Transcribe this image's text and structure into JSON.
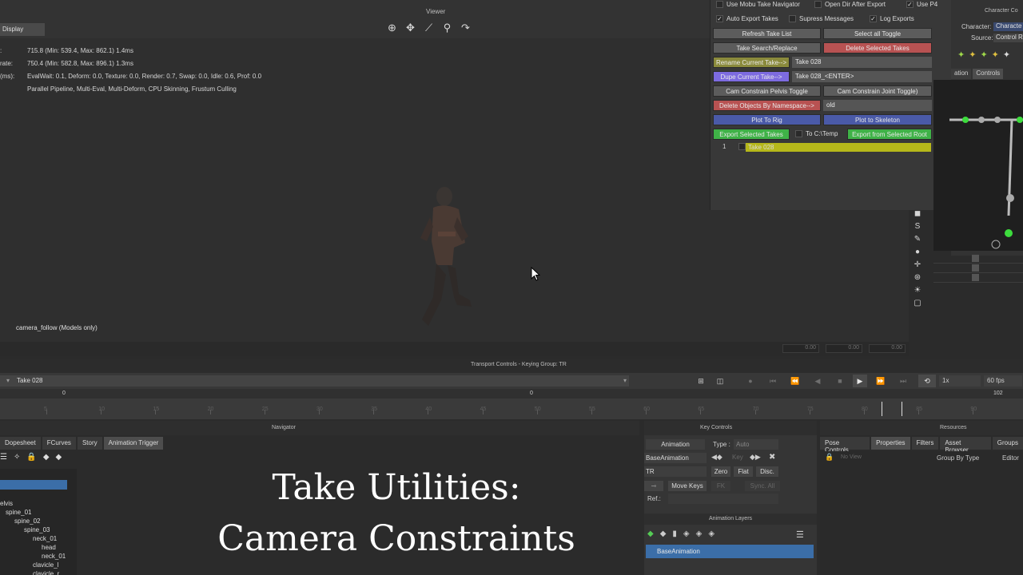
{
  "viewer": {
    "title": "Viewer",
    "display_tab": "Display",
    "stats": [
      {
        "key": ":",
        "value": "715.8  (Min: 539.4, Max: 862.1)  1.4ms"
      },
      {
        "key": "rate:",
        "value": "750.4  (Min: 582.8, Max: 896.1)  1.3ms"
      },
      {
        "key": "(ms):",
        "value": "EvalWait: 0.1, Deform: 0.0, Texture: 0.0, Render: 0.7, Swap: 0.0, Idle: 0.6, Prof: 0.0"
      },
      {
        "key": "",
        "value": "Parallel Pipeline, Multi-Eval, Multi-Deform, CPU Skinning, Frustum Culling"
      }
    ],
    "model_label": "camera_follow (Models only)",
    "bottom_values": [
      "0.00",
      "0.00",
      "0.00"
    ]
  },
  "panel": {
    "checks_row1": [
      {
        "label": "Use Mobu Take Navigator",
        "checked": false
      },
      {
        "label": "Open Dir After Export",
        "checked": false
      },
      {
        "label": "Use P4",
        "checked": true
      }
    ],
    "checks_row2": [
      {
        "label": "Auto Export Takes",
        "checked": true
      },
      {
        "label": "Supress Messages",
        "checked": false
      },
      {
        "label": "Log Exports",
        "checked": true
      }
    ],
    "refresh": "Refresh Take List",
    "select_all": "Select all Toggle",
    "search_replace": "Take Search/Replace",
    "delete_selected": "Delete Selected Takes",
    "rename_current": "Rename Current Take-->",
    "rename_value": "Take 028",
    "dupe_current": "Dupe Current Take-->",
    "dupe_value": "Take 028_<ENTER>",
    "cam_pelvis": "Cam Constrain Pelvis Toggle",
    "cam_joint": "Cam Constrain Joint Toggle)",
    "delete_ns": "Delete Objects By Namespace-->",
    "ns_value": "old",
    "plot_rig": "Plot To Rig",
    "plot_skel": "Plot to Skeleton",
    "export_selected": "Export Selected Takes",
    "to_temp": "To C:\\Temp",
    "export_root": "Export from Selected Root",
    "take_index": "1",
    "take_name": "Take 028"
  },
  "character": {
    "title": "Character Co",
    "character_label": "Character:",
    "character_value": "Characte",
    "source_label": "Source:",
    "source_value": "Control R",
    "tab1": "ation",
    "tab2": "Controls"
  },
  "transport": {
    "title": "Transport Controls  -  Keying Group: TR",
    "take": "Take 028",
    "speed": "1x",
    "fps": "60 fps",
    "start_frame": "0",
    "end_frame": "102",
    "mid_frame": "0",
    "ruler_labels": [
      "5",
      "10",
      "15",
      "20",
      "25",
      "30",
      "35",
      "40",
      "45",
      "50",
      "55",
      "60",
      "65",
      "70",
      "75",
      "80",
      "85",
      "90"
    ]
  },
  "bottom": {
    "navigator_title": "Navigator",
    "tabs": [
      "Dopesheet",
      "FCurves",
      "Story",
      "Animation Trigger"
    ],
    "tree": [
      "elvis",
      "spine_01",
      "spine_02",
      "spine_03",
      "neck_01",
      "head",
      "neck_01",
      "clavicle_l",
      "clavicle_r"
    ],
    "overlay_line1": "Take Utilities:",
    "overlay_line2": "Camera Constraints",
    "key_controls_title": "Key Controls",
    "kc_animation": "Animation",
    "kc_type_label": "Type :",
    "kc_type_value": "Auto",
    "kc_layer": "BaseAnimation",
    "kc_key": "Key",
    "kc_tr": "TR",
    "kc_zero": "Zero",
    "kc_flat": "Flat",
    "kc_disc": "Disc.",
    "kc_move": "Move Keys",
    "kc_fk": "FK",
    "kc_sync": "Sync. All",
    "kc_ref": "Ref.:",
    "layers_title": "Animation Layers",
    "layer_name": "BaseAnimation",
    "resources_title": "Resources",
    "res_tabs": [
      "Pose Controls",
      "Properties",
      "Filters",
      "Asset Browser",
      "Groups"
    ],
    "res_noview": "No View",
    "res_group": "Group By Type",
    "res_editor": "Editor"
  }
}
